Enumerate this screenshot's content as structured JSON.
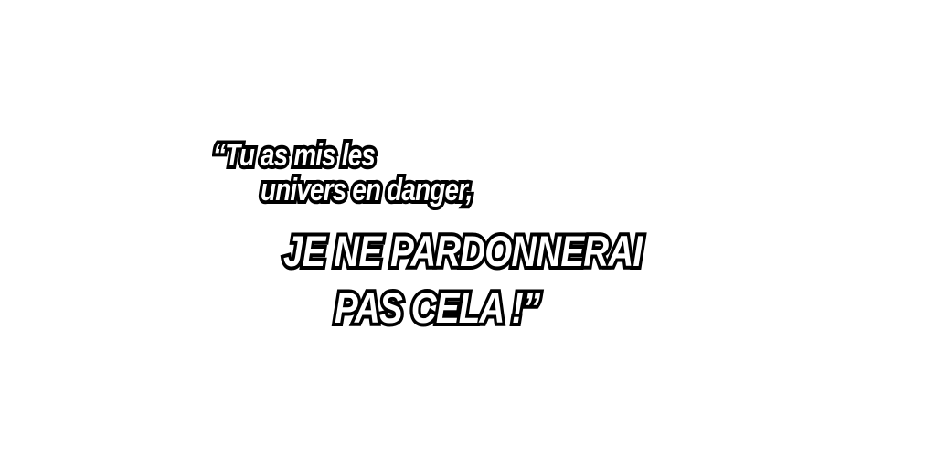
{
  "quote": {
    "line1": "“Tu as mis les",
    "line2": "univers en danger,",
    "line3": "JE NE PARDONNERAI",
    "line4": "PAS CELA !”"
  }
}
